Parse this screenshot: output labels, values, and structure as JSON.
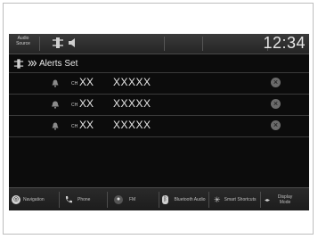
{
  "status_bar": {
    "audio_source_label": "Audio Source",
    "clock": "12:34"
  },
  "header": {
    "title": "Alerts Set"
  },
  "alerts": [
    {
      "ch_prefix": "CH",
      "channel": "XX",
      "name": "XXXXX",
      "icon": "bell-icon"
    },
    {
      "ch_prefix": "CH",
      "channel": "XX",
      "name": "XXXXX",
      "icon": "bell-icon"
    },
    {
      "ch_prefix": "CH",
      "channel": "XX",
      "name": "XXXXX",
      "icon": "bell-icon"
    }
  ],
  "bottom_nav": [
    {
      "label": "Navigation",
      "icon": "navigation-icon"
    },
    {
      "label": "Phone",
      "icon": "phone-icon"
    },
    {
      "label": "FM",
      "icon": "radio-icon"
    },
    {
      "label": "Bluetooth Audio",
      "icon": "bluetooth-icon"
    },
    {
      "label": "Smart Shortcuts",
      "icon": "shortcuts-icon"
    },
    {
      "label": "Display Mode",
      "icon": "display-mode-icon"
    }
  ]
}
